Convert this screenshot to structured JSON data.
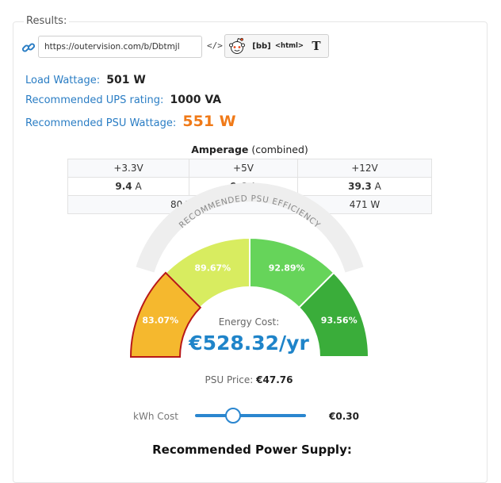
{
  "results": {
    "legend": "Results:",
    "share_url": "https://outervision.com/b/Dbtmjl",
    "embed_code_icon_text": "</>",
    "share_buttons": [
      {
        "name": "reddit",
        "label": ""
      },
      {
        "name": "bbcode",
        "label": "[bb]"
      },
      {
        "name": "html",
        "label": "<html>"
      },
      {
        "name": "text",
        "label": "T"
      }
    ]
  },
  "stats": {
    "load_wattage_label": "Load Wattage:",
    "load_wattage_value": "501 W",
    "ups_label": "Recommended UPS rating:",
    "ups_value": "1000 VA",
    "psu_label": "Recommended PSU Wattage:",
    "psu_value": "551 W"
  },
  "amperage": {
    "title_bold": "Amperage",
    "title_rest": " (combined)",
    "rails": [
      "+3.3V",
      "+5V",
      "+12V"
    ],
    "amps": [
      "9.4",
      "9.6",
      "39.3"
    ],
    "amp_unit": "A",
    "watts_combined": "80 W",
    "watts_12v": "471 W"
  },
  "gauge": {
    "arc_title": "RECOMMENDED PSU EFFICIENCY",
    "segments": [
      {
        "label": "83.07%",
        "color": "#f5b82e",
        "selected": true
      },
      {
        "label": "89.67%",
        "color": "#d8ec60",
        "selected": false
      },
      {
        "label": "92.89%",
        "color": "#66d45a",
        "selected": false
      },
      {
        "label": "93.56%",
        "color": "#3aad3a",
        "selected": false
      }
    ],
    "selected_border_color": "#b81818"
  },
  "energy": {
    "label": "Energy Cost:",
    "value": "€528.32/yr"
  },
  "psu_price": {
    "label": "PSU Price:",
    "value": "€47.76"
  },
  "kwh": {
    "label": "kWh Cost",
    "value": "€0.30",
    "slider_fraction": 0.34
  },
  "recommended_psu_heading": "Recommended Power Supply:"
}
